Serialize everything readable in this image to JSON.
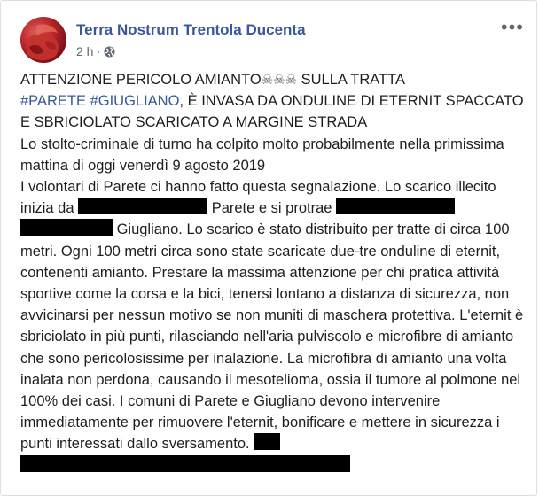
{
  "post": {
    "page_name": "Terra Nostrum Trentola Ducenta",
    "time": "2 h",
    "separator": "·",
    "more_label": "•••",
    "headline_start": "ATTENZIONE PERICOLO AMIANTO",
    "skulls": "☠☠☠",
    "headline_after_skulls": " SULLA TRATTA",
    "hashtag_1": "#PARETE",
    "hashtag_2": "#GIUGLIANO",
    "headline_rest": ", È INVASA DA ONDULINE DI ETERNIT SPACCATO E SBRICIOLATO SCARICATO A MARGINE STRADA",
    "paragraph_1": "Lo stolto-criminale di turno ha colpito molto probabilmente nella primissima mattina di oggi venerdì 9 agosto 2019",
    "paragraph_2_a": "I volontari di Parete ci hanno fatto questa segnalazione. Lo scarico illecito inizia da ",
    "paragraph_2_b": " Parete e si protrae ",
    "paragraph_2_c": " Giugliano. Lo scarico è stato distribuito per tratte di circa 100 metri. Ogni 100 metri circa sono state scaricate due-tre onduline di eternit, contenenti amianto. Prestare la massima attenzione per chi pratica attività sportive come la corsa e la bici, tenersi lontano a distanza di sicurezza, non avvicinarsi per nessun motivo se non muniti di maschera protettiva. L'eternit è sbriciolato in più punti, rilasciando nell'aria pulviscolo e microfibre di amianto che sono pericolosissime per inalazione. La microfibra di amianto una volta inalata non perdona, causando il mesotelioma, ossia il tumore al polmone nel 100% dei casi. I comuni di Parete e Giugliano devono intervenire immediatamente per rimuovere l'eternit, bonificare e mettere in sicurezza i punti interessati dallo sversamento."
  },
  "icons": {
    "avatar": "page-avatar",
    "privacy": "globe-icon",
    "more": "more-options-icon"
  },
  "colors": {
    "link": "#385898",
    "meta": "#606770",
    "text": "#1c1e21",
    "redaction": "#000000"
  }
}
